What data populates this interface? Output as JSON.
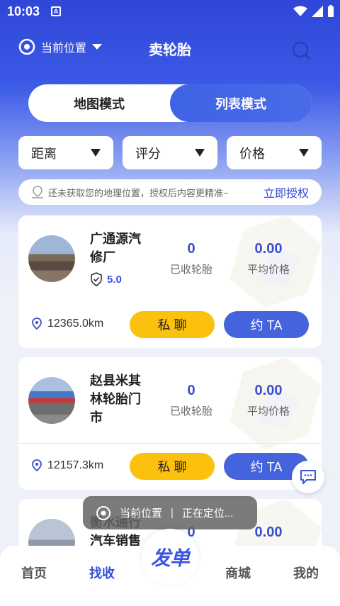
{
  "status": {
    "time": "10:03"
  },
  "header": {
    "location_label": "当前位置",
    "title": "卖轮胎"
  },
  "mode": {
    "map": "地图模式",
    "list": "列表模式",
    "active": "list"
  },
  "filters": {
    "distance": "距离",
    "rating": "评分",
    "price": "价格"
  },
  "notice": {
    "text": "还未获取您的地理位置，授权后内容更精准~",
    "action": "立即授权"
  },
  "shops": [
    {
      "name": "广通源汽修厂",
      "rating": "5.0",
      "tires_received": "0",
      "tires_label": "已收轮胎",
      "avg_price": "0.00",
      "avg_label": "平均价格",
      "distance": "12365.0km",
      "chat": "私 聊",
      "appointment": "约 TA"
    },
    {
      "name": "赵县米其林轮胎门市",
      "tires_received": "0",
      "tires_label": "已收轮胎",
      "avg_price": "0.00",
      "avg_label": "平均价格",
      "distance": "12157.3km",
      "chat": "私 聊",
      "appointment": "约 TA"
    },
    {
      "name": "衡水通行汽车销售",
      "tires_received": "0",
      "avg_price": "0.00"
    }
  ],
  "toast": {
    "label": "当前位置",
    "sep": "|",
    "status": "正在定位..."
  },
  "tabbar": {
    "home": "首页",
    "find": "找收",
    "post": "发单",
    "mall": "商城",
    "mine": "我的",
    "active": "find"
  },
  "colors": {
    "primary": "#3350d8",
    "chat_button": "#fcc10c",
    "appointment_button": "#4563dc"
  }
}
